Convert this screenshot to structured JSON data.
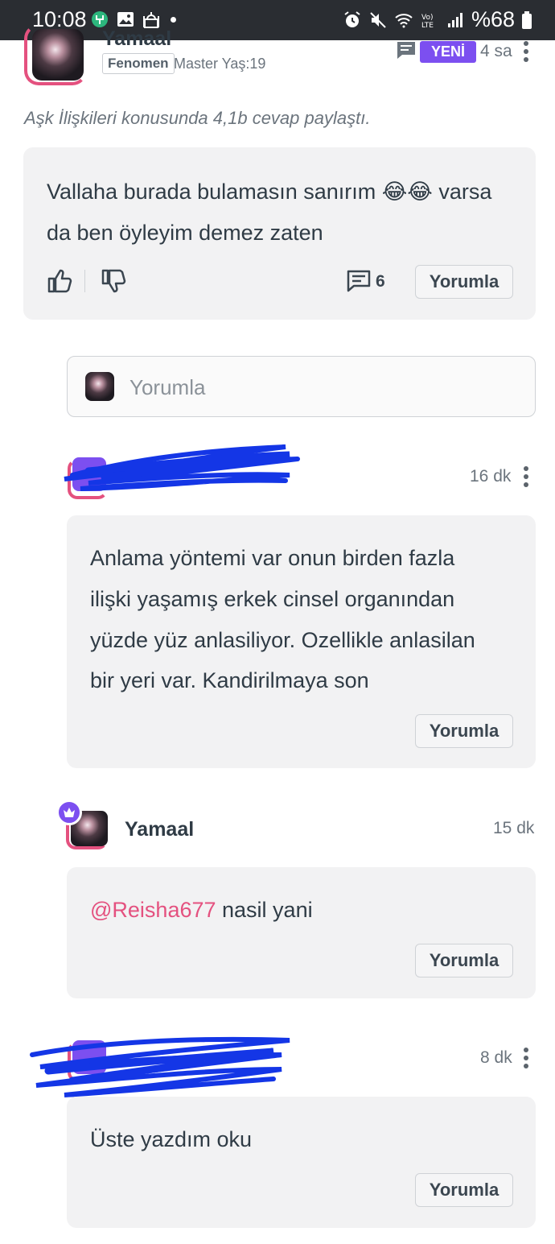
{
  "status_bar": {
    "time": "10:08",
    "battery": "%68",
    "icons_left": [
      "vpn-icon",
      "gallery-icon",
      "mosque-icon",
      "dot"
    ],
    "icons_right": [
      "alarm-icon",
      "mute-icon",
      "wifi-icon",
      "volte-icon",
      "signal-icon",
      "battery-icon"
    ]
  },
  "post": {
    "author": "Yamaal",
    "badge": "Fenomen",
    "meta": "Master Yaş:19",
    "new_label": "YENİ",
    "time": "4 sa",
    "activity": "Aşk İlişkileri konusunda 4,1b cevap paylaştı.",
    "text_line1": "Vallaha burada bulamasın sanırım 😂😂 varsa",
    "text_line2": "da ben öyleyim demez zaten",
    "comment_count": "6",
    "reply_label": "Yorumla"
  },
  "comment_input": {
    "placeholder": "Yorumla"
  },
  "comments": [
    {
      "author": "",
      "time": "16 dk",
      "lines": [
        "Anlama yöntemi var onun birden fazla",
        "ilişki yaşamış erkek cinsel organından",
        "yüzde yüz anlasiliyor. Ozellikle anlasilan",
        "bir yeri var. Kandirilmaya son"
      ],
      "reply_label": "Yorumla"
    },
    {
      "author": "Yamaal",
      "time": "15 dk",
      "mention": "@Reisha677",
      "text": " nasil yani",
      "reply_label": "Yorumla"
    },
    {
      "author": "",
      "time": "8 dk",
      "text": "Üste yazdım oku",
      "reply_label": "Yorumla"
    }
  ],
  "colors": {
    "accent_purple": "#7c4ff0",
    "accent_pink": "#e4517f",
    "scribble_blue": "#1436e6",
    "card_bg": "#f2f2f3"
  }
}
